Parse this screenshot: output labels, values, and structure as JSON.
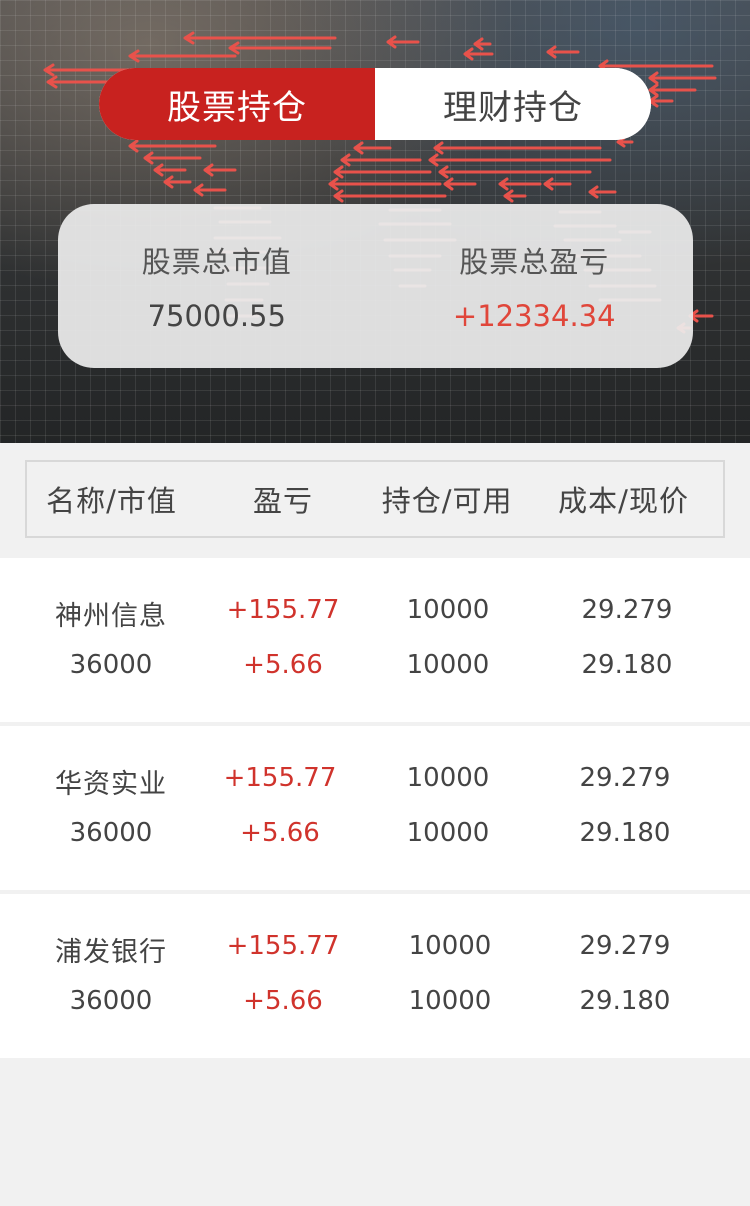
{
  "tabs": [
    {
      "label": "股票持仓",
      "active": true
    },
    {
      "label": "理财持仓",
      "active": false
    }
  ],
  "summary": {
    "market_value_label": "股票总市值",
    "market_value": "75000.55",
    "profit_label": "股票总盈亏",
    "profit": "+12334.34"
  },
  "table": {
    "headers": [
      "名称/市值",
      "盈亏",
      "持仓/可用",
      "成本/现价"
    ],
    "rows": [
      {
        "name": "神州信息",
        "market_value": "36000",
        "profit": "+155.77",
        "profit_pct": "+5.66",
        "position": "10000",
        "available": "10000",
        "cost": "29.279",
        "price": "29.180"
      },
      {
        "name": "华资实业",
        "market_value": "36000",
        "profit": "+155.77",
        "profit_pct": "+5.66",
        "position": "10000",
        "available": "10000",
        "cost": "29.279",
        "price": "29.180"
      },
      {
        "name": "浦发银行",
        "market_value": "36000",
        "profit": "+155.77",
        "profit_pct": "+5.66",
        "position": "10000",
        "available": "10000",
        "cost": "29.279",
        "price": "29.180"
      }
    ]
  },
  "colors": {
    "accent": "#c8221f",
    "profit_red": "#d0332c",
    "background": "#f1f1f1"
  }
}
